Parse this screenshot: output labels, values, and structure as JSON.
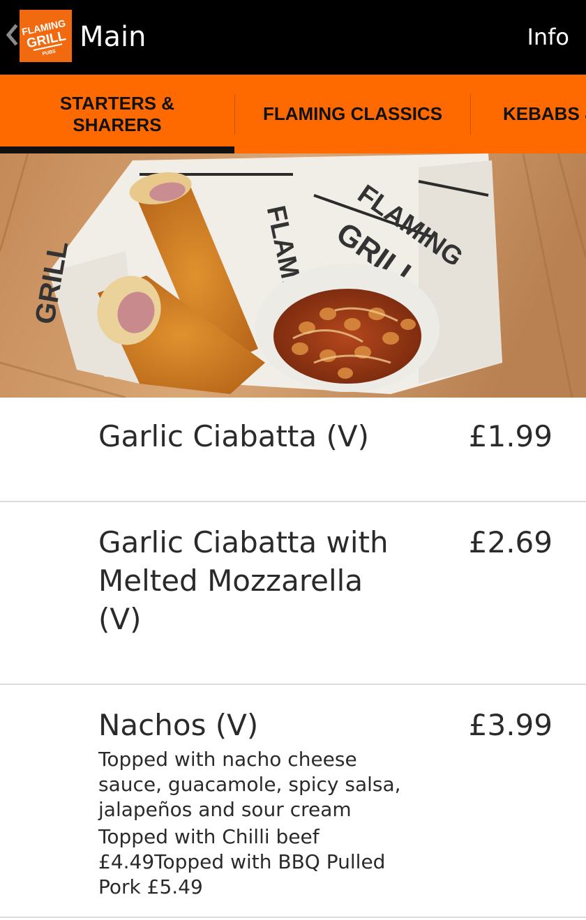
{
  "appbar": {
    "title": "Main",
    "info_label": "Info",
    "logo_text": [
      "FLAMING",
      "GRILL",
      "PUBS"
    ],
    "back_icon": "chevron-left-icon"
  },
  "tabs": [
    {
      "label_lines": [
        "STARTERS &",
        "SHARERS"
      ],
      "selected": true
    },
    {
      "label_lines": [
        "FLAMING CLASSICS"
      ],
      "selected": false
    },
    {
      "label_lines": [
        "KEBABS &"
      ],
      "selected": false
    }
  ],
  "hero": {
    "wrapper_print": [
      "FLAMING",
      "GRILL"
    ]
  },
  "menu": {
    "items": [
      {
        "name": "Garlic Ciabatta (V)",
        "price": "£1.99"
      },
      {
        "name": "Garlic Ciabatta with Melted Mozzarella (V)",
        "price": "£2.69"
      },
      {
        "name": "Nachos (V)",
        "price": "£3.99",
        "description": "Topped with nacho cheese sauce, guacamole, spicy salsa, jalapeños and sour cream",
        "extras": "Topped with Chilli beef £4.49Topped with BBQ Pulled Pork £5.49"
      }
    ]
  },
  "colors": {
    "appbar_bg": "#000000",
    "accent_orange": "#ff6a00",
    "tab_indicator": "#111111",
    "divider": "#dcdcdc",
    "text": "#2a2a2a"
  }
}
